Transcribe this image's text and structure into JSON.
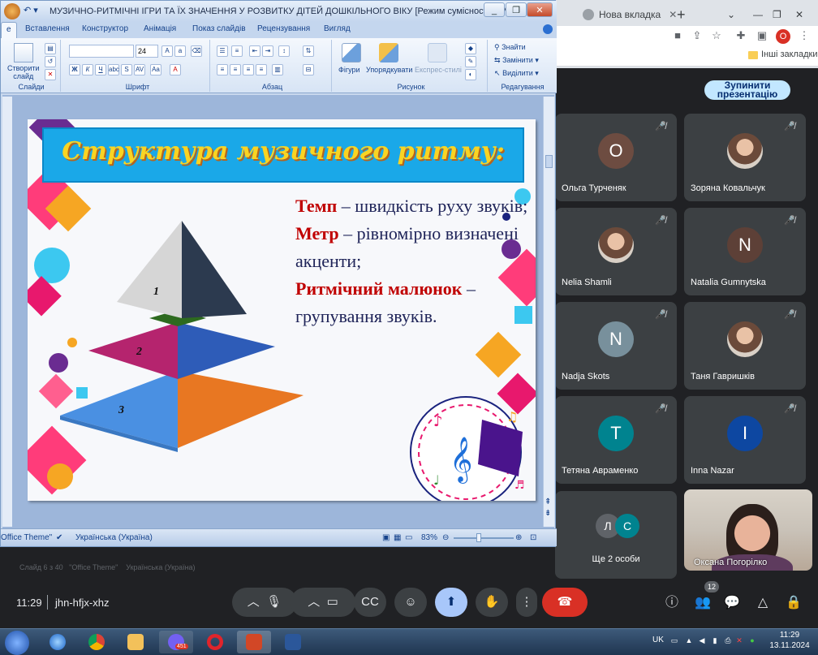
{
  "chrome": {
    "tab_new_label": "Нова вкладка",
    "new_tab_button": "+",
    "bookmarks_other": "Інші закладки",
    "profile_letter": "O"
  },
  "meet": {
    "stop_presenting": "Зупинити\nпрезентацію",
    "time": "11:29",
    "code": "jhn-hfjx-xhz",
    "people_count": "12",
    "participants": [
      {
        "name": "Ольга Турченяк",
        "initial": "О",
        "color": "#6d4c41",
        "photo": false
      },
      {
        "name": "Зоряна Ковальчук",
        "initial": "",
        "color": "#9e6b52",
        "photo": true
      },
      {
        "name": "Nelia Shamli",
        "initial": "",
        "color": "#a56f5a",
        "photo": true
      },
      {
        "name": "Natalia Gumnytska",
        "initial": "N",
        "color": "#5d4037",
        "photo": false
      },
      {
        "name": "Nadja Skots",
        "initial": "N",
        "color": "#78909c",
        "photo": false
      },
      {
        "name": "Таня Гавришків",
        "initial": "",
        "color": "#8d6e63",
        "photo": true
      },
      {
        "name": "Тетяна Авраменко",
        "initial": "T",
        "color": "#00838f",
        "photo": false
      },
      {
        "name": "Inna Nazar",
        "initial": "I",
        "color": "#0d47a1",
        "photo": false
      }
    ],
    "more_people": {
      "label": "Ще 2 особи",
      "a": "Л",
      "b": "С",
      "a_color": "#5f6368",
      "b_color": "#00838f"
    },
    "video_name": "Оксана Погорілко"
  },
  "ppt": {
    "title": "МУЗИЧНО-РИТМІЧНІ ІГРИ ТА ЇХ ЗНАЧЕННЯ У РОЗВИТКУ ДІТЕЙ ДОШКІЛЬНОГО ВІКУ [Режим сумісності] - Microsoft...",
    "tabs": [
      "е",
      "Вставлення",
      "Конструктор",
      "Анімація",
      "Показ слайдів",
      "Рецензування",
      "Вигляд"
    ],
    "groups": {
      "slides": "Слайди",
      "font": "Шрифт",
      "paragraph": "Абзац",
      "drawing": "Рисунок",
      "editing": "Редагування"
    },
    "buttons": {
      "new_slide": "Створити\nслайд",
      "font_size": "24",
      "shapes": "Фігури",
      "arrange": "Упорядкувати",
      "quick_styles": "Експрес-стилі",
      "find": "Знайти",
      "replace": "Замінити",
      "select": "Виділити"
    },
    "status": {
      "theme": "Office Theme\"",
      "language": "Українська (Україна)",
      "zoom": "83%"
    },
    "slide": {
      "title": "Структура музичного ритму:",
      "tempo_term": "Темп",
      "tempo_def": " – швидкість руху звуків;",
      "meter_term": "Метр",
      "meter_def": " – рівномірно визначені акценти;",
      "rhythm_term": "Ритмічний малюнок",
      "rhythm_def": " –групування звуків.",
      "levels": [
        "1",
        "2",
        "3"
      ]
    }
  },
  "taskbar": {
    "lang": "UK",
    "time": "11:29",
    "date": "13.11.2024",
    "viber_badge": "451"
  }
}
